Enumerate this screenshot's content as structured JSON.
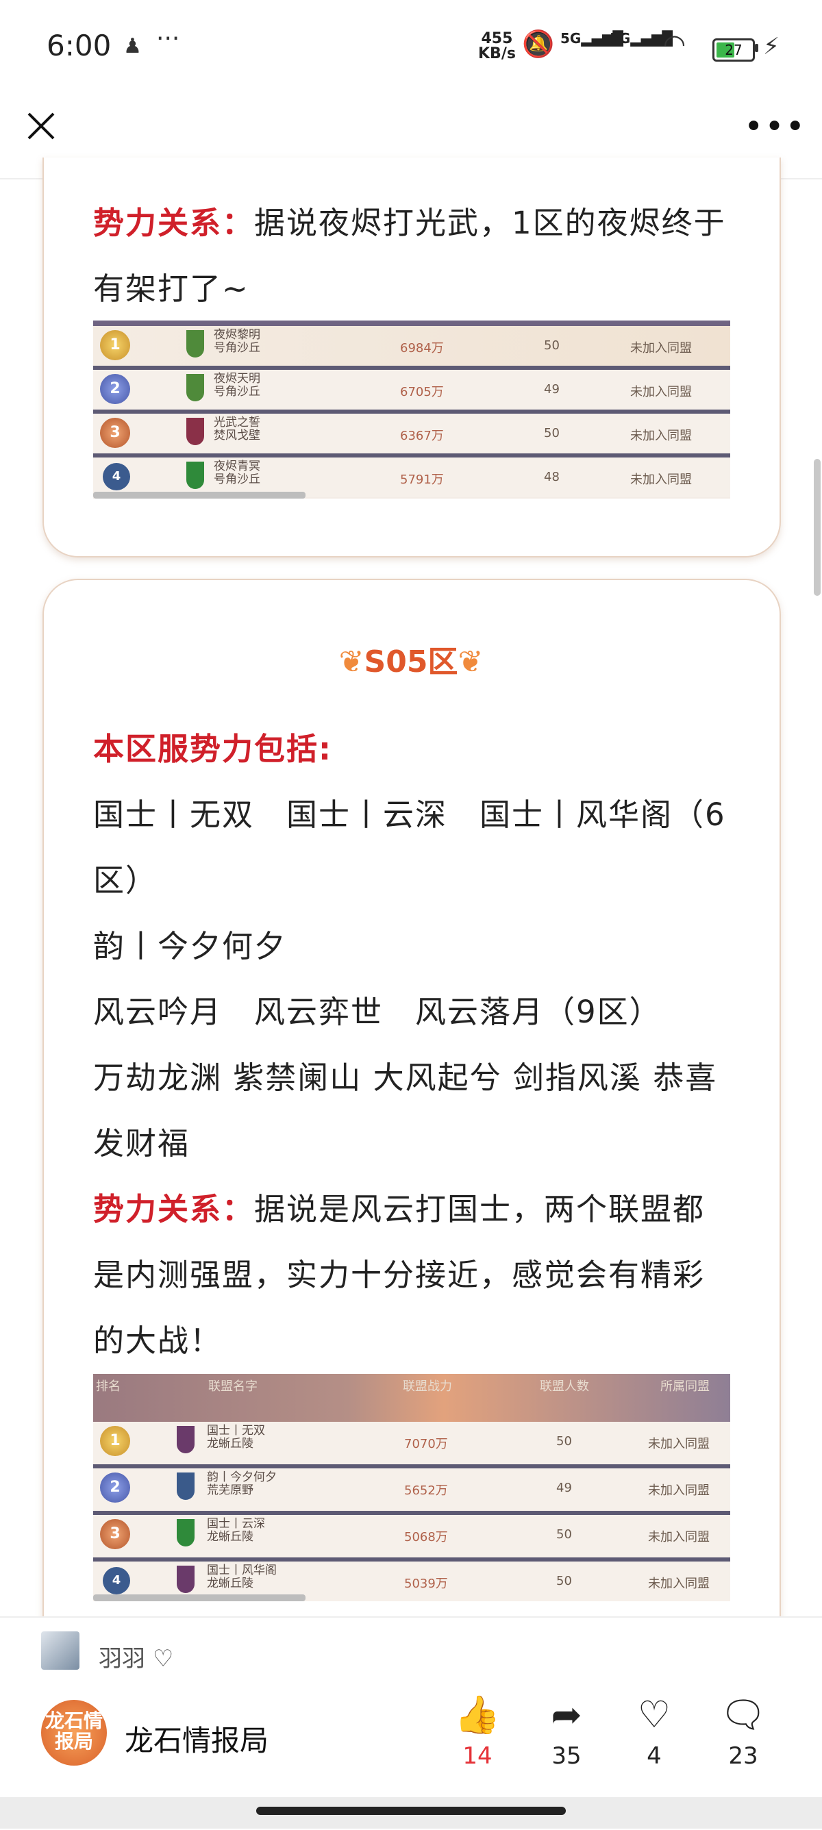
{
  "status_bar": {
    "time": "6:00",
    "net_speed_top": "455",
    "net_speed_bottom": "KB/s",
    "signal1": "5G",
    "signal2": "5G",
    "battery": "27"
  },
  "card1": {
    "relation_label": "势力关系：",
    "relation_text": "据说夜烬打光武，1区的夜烬终于有架打了~",
    "table": {
      "rows": [
        {
          "rank": "1",
          "name": "夜烬黎明",
          "sub": "号角沙丘",
          "power": "6984万",
          "members": "50",
          "status": "未加入同盟"
        },
        {
          "rank": "2",
          "name": "夜烬天明",
          "sub": "号角沙丘",
          "power": "6705万",
          "members": "49",
          "status": "未加入同盟"
        },
        {
          "rank": "3",
          "name": "光武之誓",
          "sub": "焚风戈壁",
          "power": "6367万",
          "members": "50",
          "status": "未加入同盟"
        },
        {
          "rank": "4",
          "name": "夜烬青冥",
          "sub": "号角沙丘",
          "power": "5791万",
          "members": "48",
          "status": "未加入同盟"
        }
      ]
    }
  },
  "card2": {
    "zone_title": "S05区",
    "forces_label": "本区服势力包括:",
    "lines": [
      "国士丨无双　国士丨云深　国士丨风华阁（6区）",
      "韵丨今夕何夕",
      "风云吟月　风云弈世　风云落月（9区）",
      "万劫龙渊 紫禁阑山 大风起兮 剑指风溪 恭喜发财福"
    ],
    "relation_label": "势力关系：",
    "relation_text": "据说是风云打国士，两个联盟都是内测强盟，实力十分接近，感觉会有精彩的大战！",
    "table": {
      "headers": {
        "rank": "排名",
        "name": "联盟名字",
        "power": "联盟战力",
        "members": "联盟人数",
        "alliance": "所属同盟"
      },
      "rows": [
        {
          "rank": "1",
          "name": "国士丨无双",
          "sub": "龙蜥丘陵",
          "power": "7070万",
          "members": "50",
          "status": "未加入同盟"
        },
        {
          "rank": "2",
          "name": "韵丨今夕何夕",
          "sub": "荒芜原野",
          "power": "5652万",
          "members": "49",
          "status": "未加入同盟"
        },
        {
          "rank": "3",
          "name": "国士丨云深",
          "sub": "龙蜥丘陵",
          "power": "5068万",
          "members": "50",
          "status": "未加入同盟"
        },
        {
          "rank": "4",
          "name": "国士丨风华阁",
          "sub": "龙蜥丘陵",
          "power": "5039万",
          "members": "50",
          "status": "未加入同盟"
        }
      ]
    }
  },
  "bottom": {
    "liker_name": "羽羽",
    "account_avatar_text": "龙石情报局",
    "account_name": "龙石情报局",
    "actions": {
      "like": "14",
      "share": "35",
      "favorite": "4",
      "comment": "23"
    }
  }
}
